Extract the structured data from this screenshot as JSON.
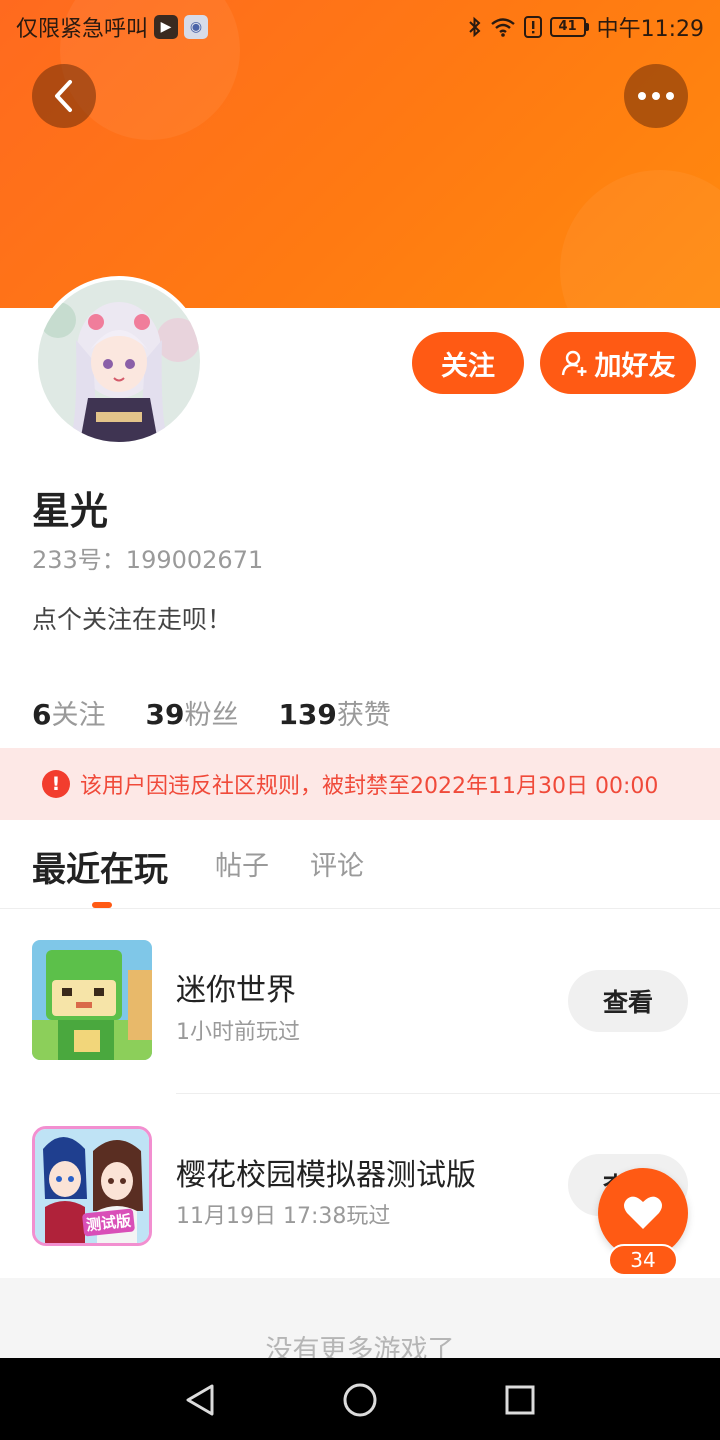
{
  "status_bar": {
    "carrier": "仅限紧急呼叫",
    "battery": "41",
    "time": "中午11:29"
  },
  "header": {
    "back_icon": "chevron-left-icon",
    "more_icon": "more-dots-icon"
  },
  "profile": {
    "name": "星光",
    "id_text": "233号：199002671",
    "bio": "点个关注在走呗！",
    "follow_label": "关注",
    "add_friend_label": "加好友"
  },
  "stats": [
    {
      "value": "6",
      "label": "关注"
    },
    {
      "value": "39",
      "label": "粉丝"
    },
    {
      "value": "139",
      "label": "获赞"
    }
  ],
  "ban_notice": "该用户因违反社区规则，被封禁至2022年11月30日 00:00",
  "tabs": [
    {
      "label": "最近在玩",
      "active": true
    },
    {
      "label": "帖子",
      "active": false
    },
    {
      "label": "评论",
      "active": false
    }
  ],
  "games": [
    {
      "name": "迷你世界",
      "played": "1小时前玩过",
      "button": "查看"
    },
    {
      "name": "樱花校园模拟器测试版",
      "played": "11月19日 17:38玩过",
      "button": "查看",
      "icon_badge": "测试版"
    }
  ],
  "footer_text": "没有更多游戏了",
  "like_count": "34",
  "colors": {
    "accent": "#ff5a14",
    "header_gradient_start": "#ff6a1f",
    "ban_bg": "#fde8e6",
    "ban_text": "#f04a3a"
  }
}
